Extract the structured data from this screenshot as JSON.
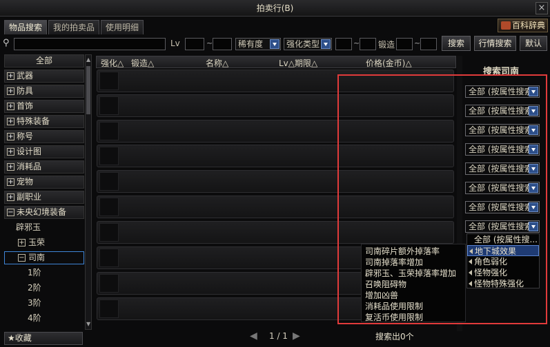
{
  "window": {
    "title": "拍卖行(B)",
    "close_label": "×"
  },
  "tabs": [
    "物品搜索",
    "我的拍卖品",
    "使用明细"
  ],
  "encyclopedia_label": "百科辞典",
  "filters": {
    "lv_label": "Lv",
    "rarity": "稀有度",
    "enhance_type": "强化类型",
    "forge_label": "锻造",
    "tilde": "~"
  },
  "buttons": {
    "search": "搜索",
    "market": "行情搜索",
    "default": "默认"
  },
  "categories": [
    {
      "label": "全部",
      "expander": ""
    },
    {
      "label": "武器",
      "expander": "+"
    },
    {
      "label": "防具",
      "expander": "+"
    },
    {
      "label": "首饰",
      "expander": "+"
    },
    {
      "label": "特殊装备",
      "expander": "+"
    },
    {
      "label": "称号",
      "expander": "+"
    },
    {
      "label": "设计图",
      "expander": "+"
    },
    {
      "label": "消耗品",
      "expander": "+"
    },
    {
      "label": "宠物",
      "expander": "+"
    },
    {
      "label": "副职业",
      "expander": "+"
    },
    {
      "label": "未央幻境装备",
      "expander": "−"
    }
  ],
  "subcategories": [
    {
      "label": "辟邪玉",
      "expander": ""
    },
    {
      "label": "玉荣",
      "expander": "+"
    },
    {
      "label": "司南",
      "expander": "−"
    },
    {
      "label": "1阶",
      "expander": ""
    },
    {
      "label": "2阶",
      "expander": ""
    },
    {
      "label": "3阶",
      "expander": ""
    },
    {
      "label": "4阶",
      "expander": ""
    }
  ],
  "favorites_label": "★收藏",
  "table_headers": [
    "强化△",
    "锻造△",
    "名称△",
    "Lv△期限△",
    "价格(金币)△"
  ],
  "pager": {
    "text": "1 / 1",
    "prev": "◀",
    "next": "▶"
  },
  "result_text": "搜索出0个",
  "right_panel": {
    "title": "搜索司南",
    "dropdown_value": "全部 (按属性搜索)",
    "menu_items": [
      "全部 (按属性搜...",
      "地下城效果",
      "角色弱化",
      "怪物强化",
      "怪物特殊强化"
    ],
    "submenu_items": [
      "司南碎片额外掉落率",
      "司南掉落率增加",
      "辟邪玉、玉荣掉落率增加",
      "召唤阻碍物",
      "增加凶兽",
      "消耗品使用限制",
      "复活币使用限制"
    ]
  },
  "colors": {
    "highlight": "#e23b3b",
    "dropdown_arrow": "#2d4f8a",
    "selection": "#3f86d8"
  }
}
